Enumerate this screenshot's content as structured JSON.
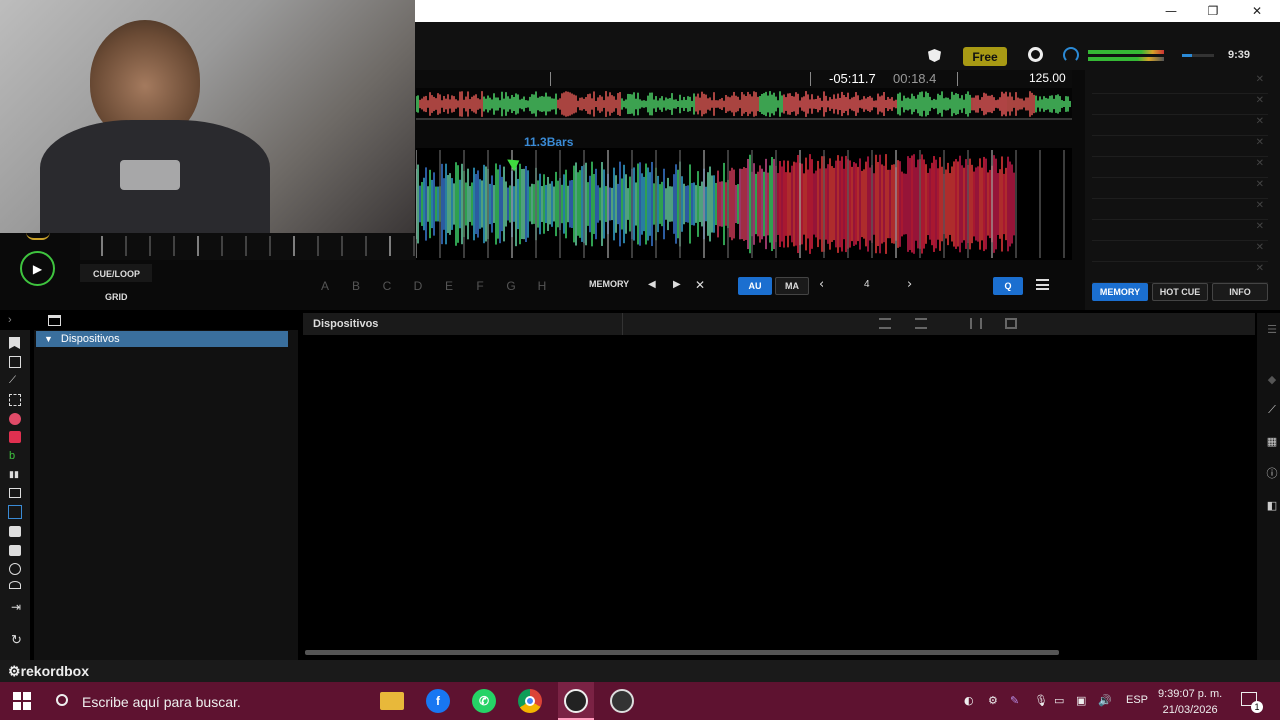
{
  "window": {
    "minimize": "—",
    "restore": "❐",
    "close": "✕"
  },
  "header": {
    "free_label": "Free",
    "clock": "9:39"
  },
  "deck": {
    "remaining_time": "-05:11.7",
    "elapsed_time": "00:18.4",
    "bpm": "125.00",
    "bars_label": "11.3Bars",
    "cue_loop_label": "CUE/LOOP",
    "grid_label": "GRID",
    "hot_cues": [
      "A",
      "B",
      "C",
      "D",
      "E",
      "F",
      "G",
      "H"
    ],
    "memory_label": "MEMORY",
    "au_label": "AU",
    "ma_label": "MA",
    "beat_value": "4",
    "q_label": "Q"
  },
  "sidepanel": {
    "tabs": [
      "MEMORY",
      "HOT CUE",
      "INFO"
    ]
  },
  "browser": {
    "tree_selected": "Dispositivos",
    "list_title": "Dispositivos"
  },
  "footer": {
    "brand": "rekordbox"
  },
  "taskbar": {
    "search_placeholder": "Escribe aquí para buscar.",
    "language": "ESP",
    "time": "9:39:07 p. m.",
    "date": "21/03/2026",
    "notifications": "1"
  },
  "colors": {
    "accent": "#1b6fd0",
    "taskbar": "#5e1230",
    "free_badge": "#a89a14",
    "play_ring": "#3fc43f"
  }
}
